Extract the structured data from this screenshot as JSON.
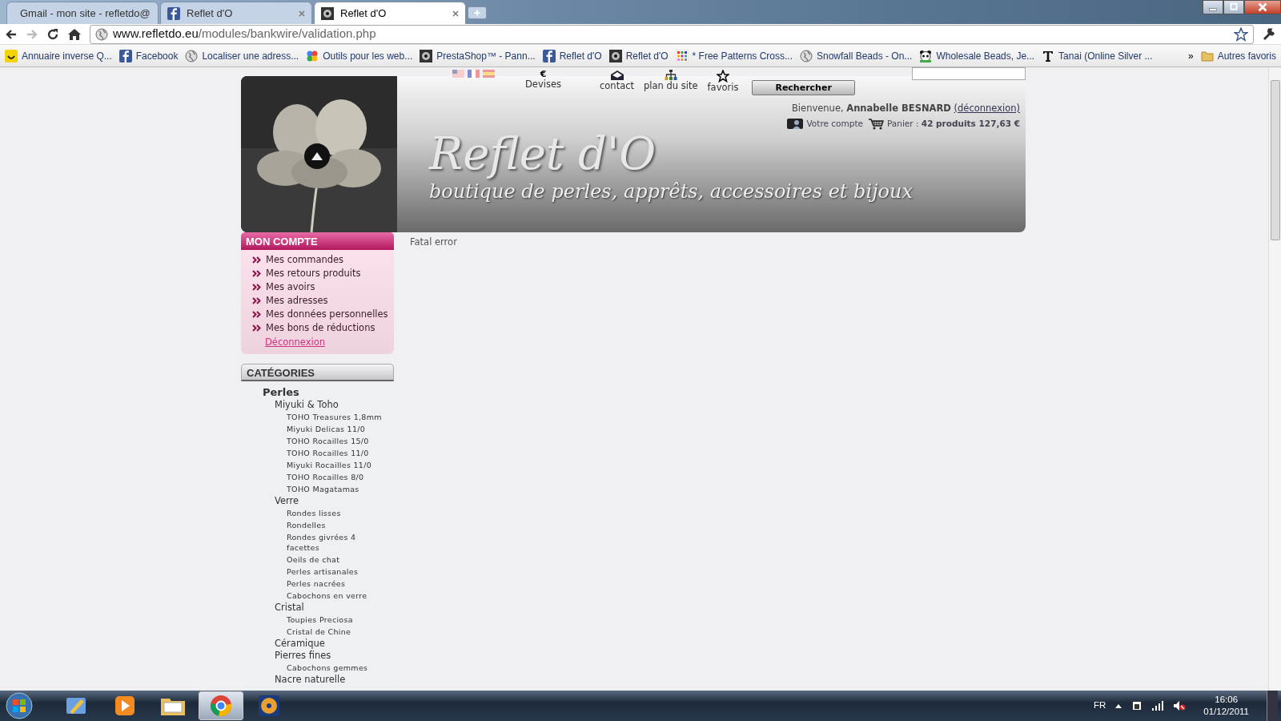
{
  "browser": {
    "tabs": [
      {
        "title": "Gmail - mon site - refletdo@",
        "kind": "gmail",
        "selected": false
      },
      {
        "title": "Reflet d'O",
        "kind": "facebook",
        "selected": false
      },
      {
        "title": "Reflet d'O",
        "kind": "site",
        "selected": true
      }
    ],
    "address": {
      "domain": "www.refletdo.eu",
      "path": "/modules/bankwire/validation.php"
    },
    "bookmarks": [
      {
        "label": "Annuaire inverse  Q...",
        "kind": "smiley"
      },
      {
        "label": "Facebook",
        "kind": "facebook"
      },
      {
        "label": "Localiser une adress...",
        "kind": "globe"
      },
      {
        "label": "Outils pour les web...",
        "kind": "google"
      },
      {
        "label": "PrestaShop™ - Pann...",
        "kind": "site"
      },
      {
        "label": "Reflet d'O",
        "kind": "facebook"
      },
      {
        "label": "Reflet d'O",
        "kind": "site"
      },
      {
        "label": "* Free Patterns Cross...",
        "kind": "grid"
      },
      {
        "label": "Snowfall Beads - On...",
        "kind": "globe"
      },
      {
        "label": "Wholesale Beads, Je...",
        "kind": "panda"
      },
      {
        "label": "Tanai (Online Silver ...",
        "kind": "letter"
      }
    ],
    "more": "»",
    "other_bookmarks": "Autres favoris"
  },
  "header": {
    "currency": {
      "symbol": "€",
      "label": "Devises"
    },
    "links": [
      {
        "label": "contact",
        "kind": "mail"
      },
      {
        "label": "plan du site",
        "kind": "sitemap"
      },
      {
        "label": "favoris",
        "kind": "star"
      }
    ],
    "search_button": "Rechercher",
    "welcome": "Bienvenue, **Annabelle BESNARD**",
    "logout": "(déconnexion)",
    "account": "Votre compte",
    "cart": "Panier : **42 produits 127,63 €**",
    "logo": "Reflet d'O",
    "tagline": "boutique de perles, apprêts, accessoires et bijoux"
  },
  "main": {
    "message": "Fatal error"
  },
  "account_block": {
    "title": "MON COMPTE",
    "items": [
      "Mes commandes",
      "Mes retours produits",
      "Mes avoirs",
      "Mes adresses",
      "Mes données personnelles",
      "Mes bons de réductions"
    ],
    "logout": "Déconnexion"
  },
  "categories": {
    "title": "CATÉGORIES",
    "tree": [
      {
        "label": "Perles",
        "children": [
          {
            "label": "Miyuki & Toho",
            "children": [
              {
                "label": "TOHO Treasures 1,8mm"
              },
              {
                "label": "Miyuki Delicas 11/0"
              },
              {
                "label": "TOHO Rocailles 15/0"
              },
              {
                "label": "TOHO Rocailles 11/0"
              },
              {
                "label": "Miyuki Rocailles 11/0"
              },
              {
                "label": "TOHO Rocailles 8/0"
              },
              {
                "label": "TOHO Magatamas"
              }
            ]
          },
          {
            "label": "Verre",
            "children": [
              {
                "label": "Rondes lisses"
              },
              {
                "label": "Rondelles"
              },
              {
                "label": "Rondes givrées 4 facettes"
              },
              {
                "label": "Oeils de chat"
              },
              {
                "label": "Perles artisanales"
              },
              {
                "label": "Perles nacrées"
              },
              {
                "label": "Cabochons en verre"
              }
            ]
          },
          {
            "label": "Cristal",
            "children": [
              {
                "label": "Toupies Preciosa"
              },
              {
                "label": "Cristal de Chine"
              }
            ]
          },
          {
            "label": "Céramique"
          },
          {
            "label": "Pierres fines",
            "children": [
              {
                "label": "Cabochons gemmes"
              }
            ]
          },
          {
            "label": "Nacre naturelle"
          }
        ]
      }
    ]
  },
  "taskbar": {
    "apps": [
      {
        "kind": "paint",
        "selected": false
      },
      {
        "kind": "media",
        "selected": false
      },
      {
        "kind": "folder",
        "selected": false
      },
      {
        "kind": "chrome",
        "selected": true
      },
      {
        "kind": "disc",
        "selected": false
      }
    ],
    "language": "FR",
    "time": "16:06",
    "date": "01/12/2011"
  }
}
